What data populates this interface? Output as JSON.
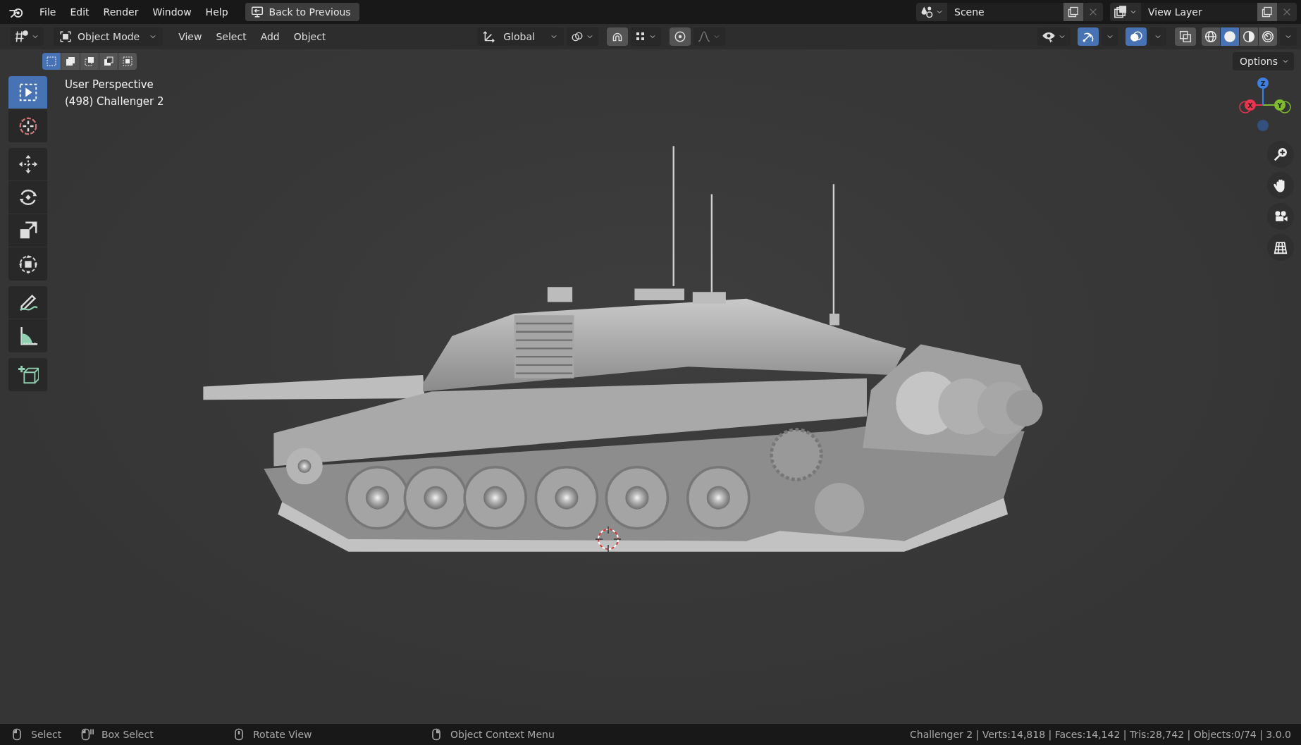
{
  "top_bar": {
    "menus": [
      "File",
      "Edit",
      "Render",
      "Window",
      "Help"
    ],
    "back_button": "Back to Previous",
    "scene": "Scene",
    "view_layer": "View Layer"
  },
  "header": {
    "mode": "Object Mode",
    "menus": [
      "View",
      "Select",
      "Add",
      "Object"
    ],
    "orientation": "Global",
    "snap_on": false,
    "proportional_on": false,
    "gizmos_on": true,
    "overlays_on": true,
    "xray_on": false,
    "shading": [
      {
        "kind": "wireframe",
        "selected": false
      },
      {
        "kind": "solid",
        "selected": true
      },
      {
        "kind": "material",
        "selected": false
      },
      {
        "kind": "rendered",
        "selected": false
      }
    ],
    "select_modes": [
      {
        "kind": "set",
        "selected": true
      },
      {
        "kind": "extend",
        "selected": false
      },
      {
        "kind": "subtract",
        "selected": false
      },
      {
        "kind": "invert",
        "selected": false
      },
      {
        "kind": "intersect",
        "selected": false
      }
    ],
    "options": "Options"
  },
  "tools": [
    {
      "kind": "select_box",
      "selected": true
    },
    {
      "kind": "cursor",
      "selected": false
    },
    {
      "kind": "move",
      "selected": false
    },
    {
      "kind": "rotate",
      "selected": false
    },
    {
      "kind": "scale",
      "selected": false
    },
    {
      "kind": "transform",
      "selected": false
    },
    {
      "kind": "annotate",
      "selected": false
    },
    {
      "kind": "measure",
      "selected": false
    },
    {
      "kind": "add_cube",
      "selected": false
    }
  ],
  "viewport": {
    "info": [
      "User Perspective",
      "(498) Challenger 2"
    ],
    "axes": [
      {
        "label": "X"
      },
      {
        "label": "Y"
      },
      {
        "label": "Z"
      }
    ],
    "nav_buttons": [
      {
        "kind": "zoom"
      },
      {
        "kind": "pan"
      },
      {
        "kind": "camera"
      },
      {
        "kind": "ortho"
      }
    ]
  },
  "status_bar": {
    "hints": [
      {
        "kind": "left_mouse",
        "label": "Select"
      },
      {
        "kind": "drag",
        "label": "Box Select"
      },
      {
        "kind": "middle_mouse",
        "label": "Rotate View"
      },
      {
        "kind": "right_mouse",
        "label": "Object Context Menu"
      }
    ],
    "stats": "Challenger 2 | Verts:14,818 | Faces:14,142 | Tris:28,742 | Objects:0/74 | 3.0.0"
  }
}
